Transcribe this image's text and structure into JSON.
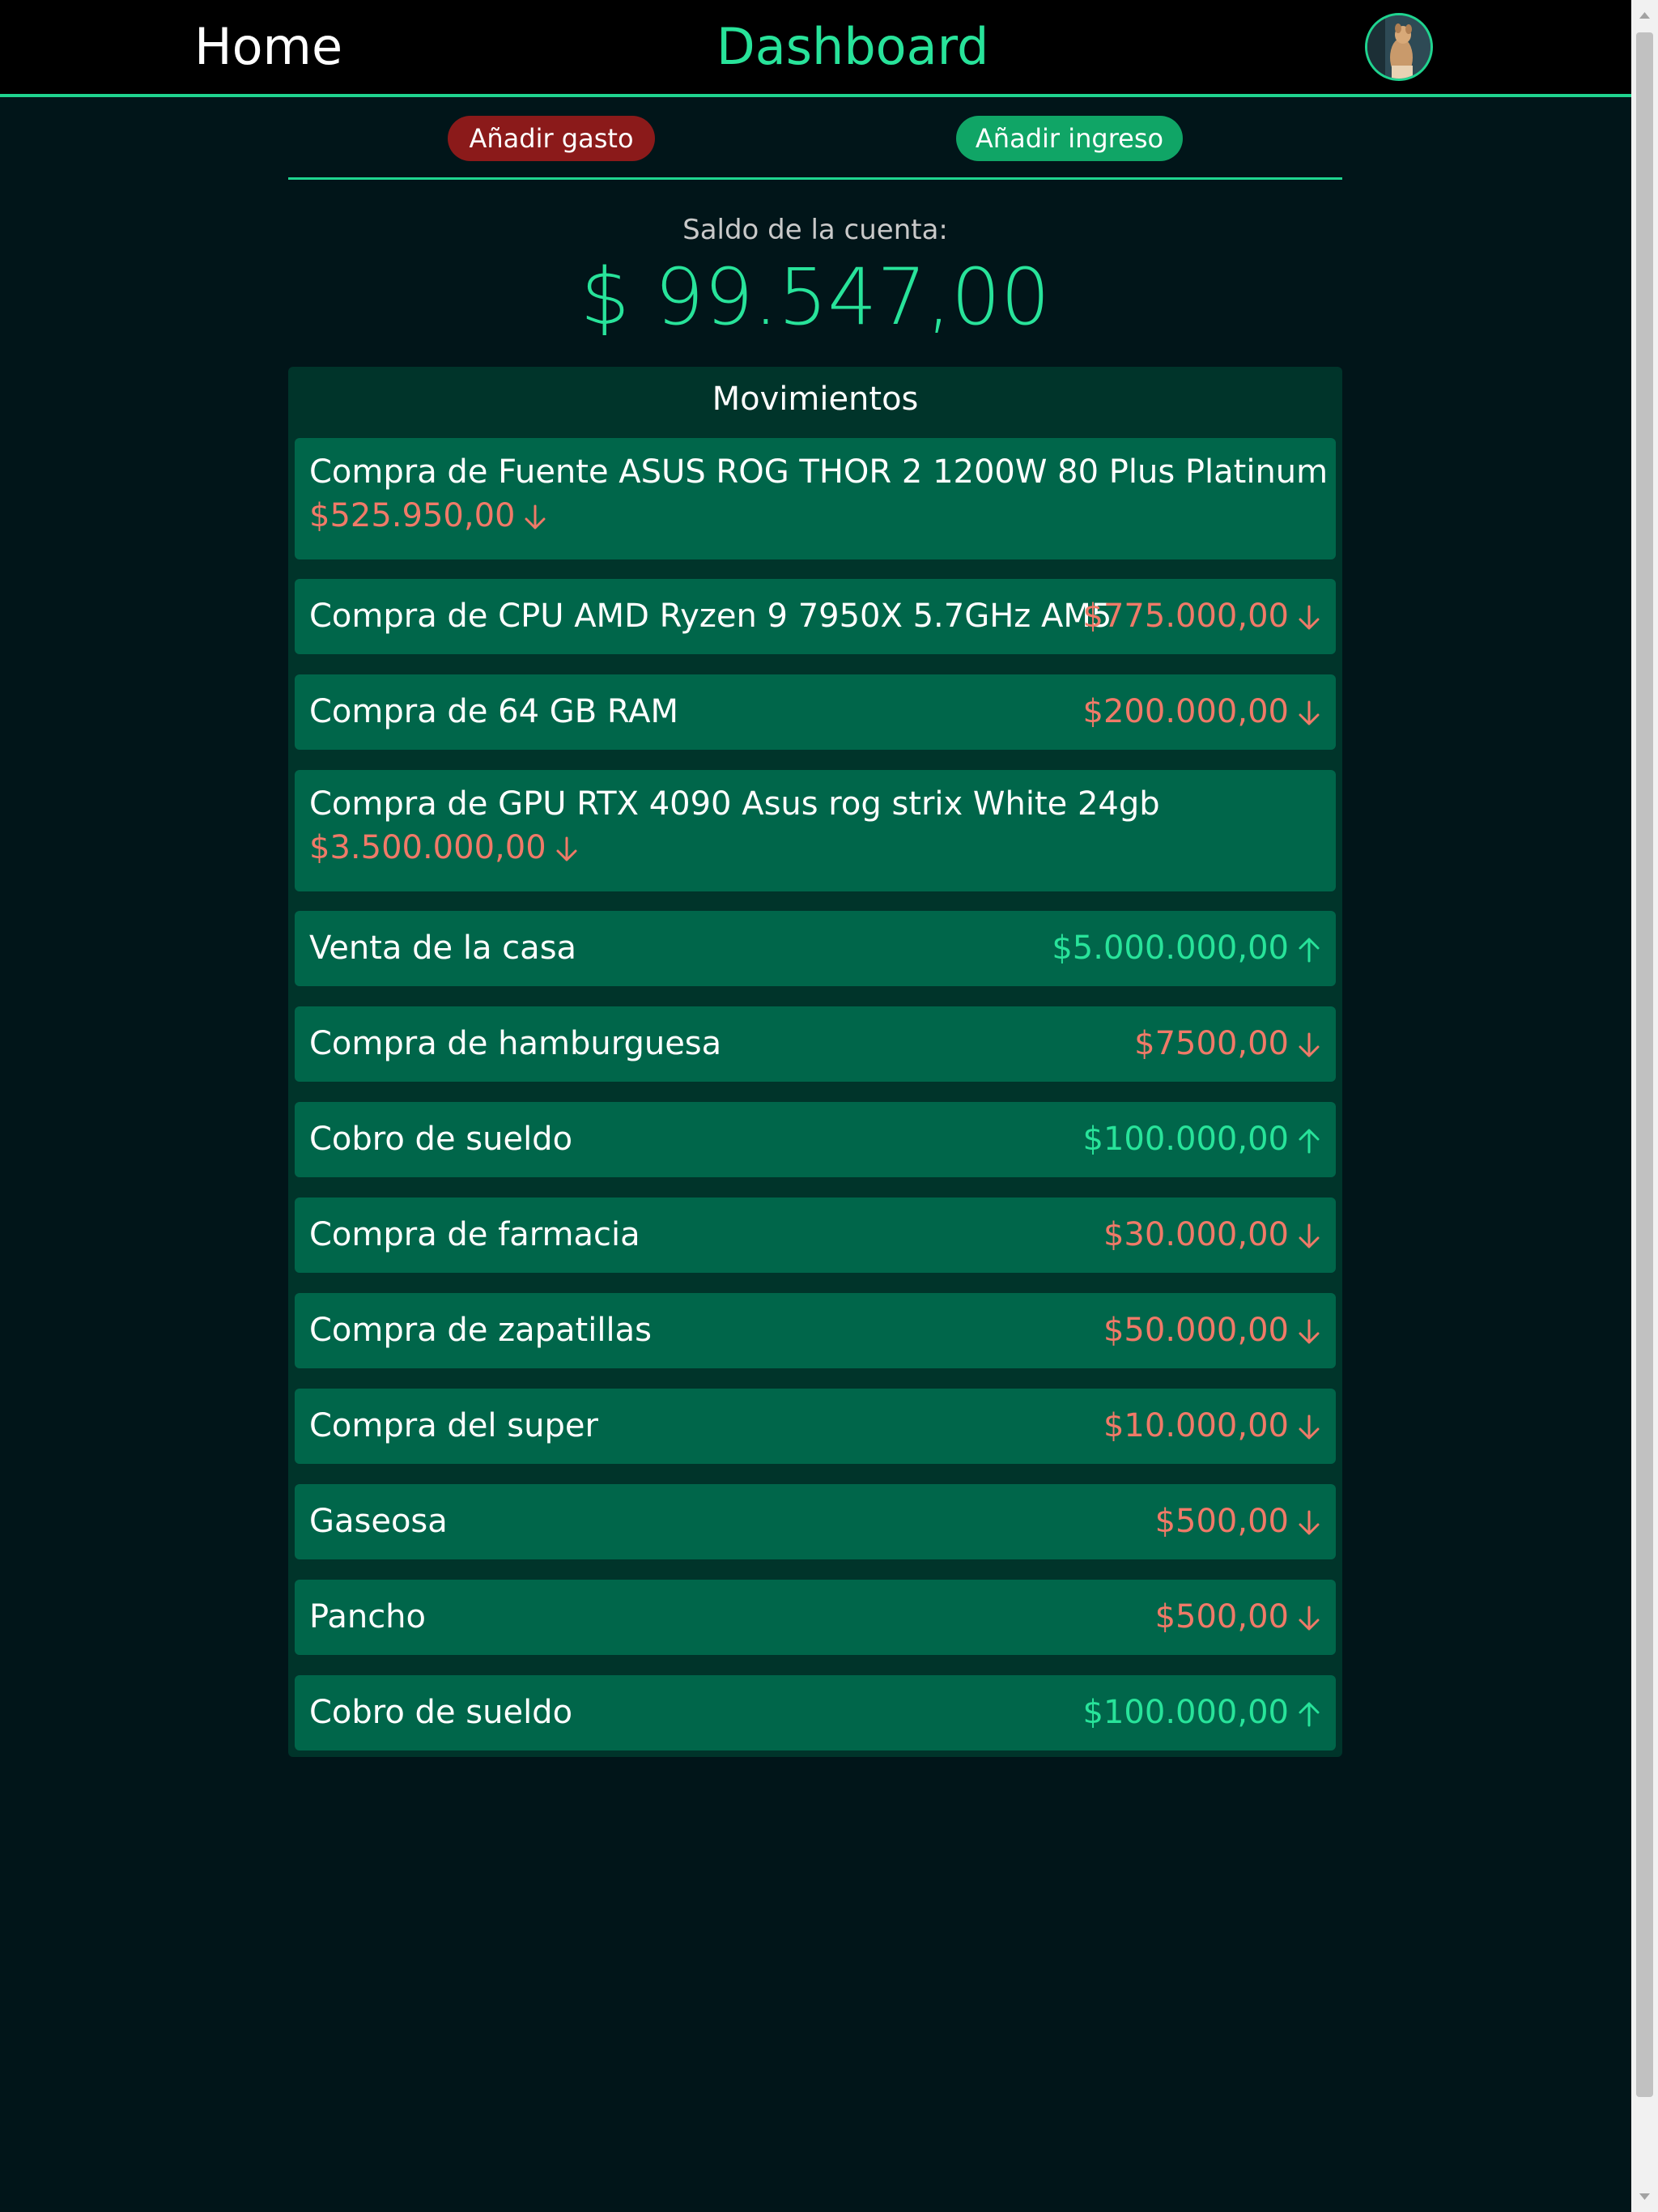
{
  "nav": {
    "home": "Home",
    "dashboard": "Dashboard"
  },
  "actions": {
    "add_expense": "Añadir gasto",
    "add_income": "Añadir ingreso"
  },
  "balance": {
    "label": "Saldo de la cuenta:",
    "amount": "$ 99.547,00"
  },
  "movements": {
    "title": "Movimientos",
    "items": [
      {
        "description": "Compra de Fuente ASUS ROG THOR 2 1200W 80 Plus Platinum",
        "amount": "$525.950,00",
        "type": "expense",
        "icon": "arrow-down-icon"
      },
      {
        "description": "Compra de CPU AMD Ryzen 9 7950X 5.7GHz AM5",
        "amount": "$775.000,00",
        "type": "expense",
        "icon": "arrow-down-icon"
      },
      {
        "description": "Compra de 64 GB RAM",
        "amount": "$200.000,00",
        "type": "expense",
        "icon": "arrow-down-icon"
      },
      {
        "description": "Compra de GPU RTX 4090 Asus rog strix White 24gb",
        "amount": "$3.500.000,00",
        "type": "expense",
        "icon": "arrow-down-icon"
      },
      {
        "description": "Venta de la casa",
        "amount": "$5.000.000,00",
        "type": "income",
        "icon": "arrow-up-icon"
      },
      {
        "description": "Compra de hamburguesa",
        "amount": "$7500,00",
        "type": "expense",
        "icon": "arrow-down-icon"
      },
      {
        "description": "Cobro de sueldo",
        "amount": "$100.000,00",
        "type": "income",
        "icon": "arrow-up-icon"
      },
      {
        "description": "Compra de farmacia",
        "amount": "$30.000,00",
        "type": "expense",
        "icon": "arrow-down-icon"
      },
      {
        "description": "Compra de zapatillas",
        "amount": "$50.000,00",
        "type": "expense",
        "icon": "arrow-down-icon"
      },
      {
        "description": "Compra del super",
        "amount": "$10.000,00",
        "type": "expense",
        "icon": "arrow-down-icon"
      },
      {
        "description": "Gaseosa",
        "amount": "$500,00",
        "type": "expense",
        "icon": "arrow-down-icon"
      },
      {
        "description": "Pancho",
        "amount": "$500,00",
        "type": "expense",
        "icon": "arrow-down-icon"
      },
      {
        "description": "Cobro de sueldo",
        "amount": "$100.000,00",
        "type": "income",
        "icon": "arrow-up-icon"
      }
    ]
  },
  "colors": {
    "background": "#011519",
    "accent": "#28e39a",
    "expense": "#f07a68",
    "income": "#28e39a",
    "expense_button": "#8b1a1a",
    "income_button": "#10a566",
    "row_background": "#00664a",
    "panel_background": "#00342a"
  }
}
